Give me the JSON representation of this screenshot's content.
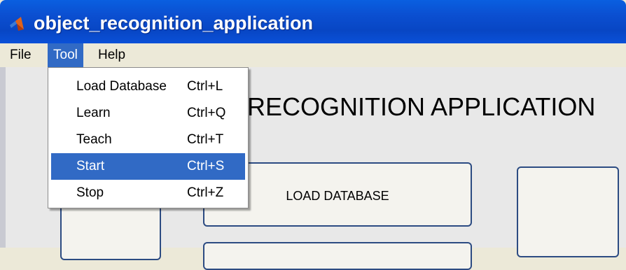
{
  "window": {
    "title": "object_recognition_application",
    "icon": "matlab-logo-icon"
  },
  "menubar": {
    "items": [
      {
        "label": "File"
      },
      {
        "label": "Tool",
        "active": true
      },
      {
        "label": "Help"
      }
    ]
  },
  "tool_menu": {
    "items": [
      {
        "label": "Load Database",
        "shortcut": "Ctrl+L"
      },
      {
        "label": "Learn",
        "shortcut": "Ctrl+Q"
      },
      {
        "label": "Teach",
        "shortcut": "Ctrl+T"
      },
      {
        "label": "Start",
        "shortcut": "Ctrl+S",
        "selected": true
      },
      {
        "label": "Stop",
        "shortcut": "Ctrl+Z"
      }
    ]
  },
  "main": {
    "title": "RECOGNITION APPLICATION",
    "load_database_button": "LOAD DATABASE"
  },
  "colors": {
    "titlebar": "#0a50d8",
    "menu_highlight": "#316ac5",
    "button_border": "#2c4b82",
    "background": "#e8e8e8"
  }
}
